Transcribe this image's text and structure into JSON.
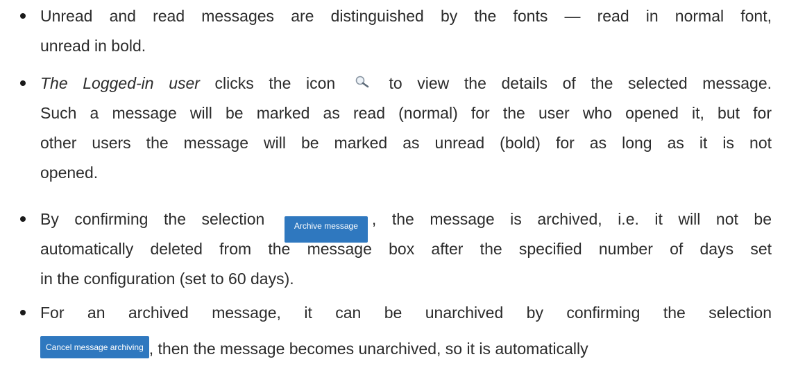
{
  "bullets": [
    {
      "lines": [
        "Unread and read messages are distinguished by the fonts — read in normal font,",
        "unread in bold."
      ]
    },
    {
      "line1_italic": "The Logged-in user",
      "line1_before_icon": " clicks the icon",
      "line1_after_icon": "to view the details of the selected message.",
      "icon": "magnifier-icon",
      "lines": [
        "Such a message will be marked as read (normal) for the user who opened it, but for",
        "other users the message will be marked as unread (bold) for as long as it is not",
        "opened."
      ]
    },
    {
      "line1_before_button": "By confirming the selection",
      "button_label": "Archive message",
      "line1_after_button": ", the message is archived, i.e. it will not be",
      "lines": [
        "automatically deleted from the message box after the specified number of days set",
        "in the configuration (set to 60 days)."
      ]
    },
    {
      "line1": "For an archived message, it can be unarchived by confirming the selection",
      "button_label": "Cancel message archiving",
      "line2_after_button": ", then the message becomes unarchived, so it is automatically"
    }
  ],
  "colors": {
    "text": "#2b2b2b",
    "button_bg": "#2f78bf",
    "button_text": "#ffffff"
  }
}
